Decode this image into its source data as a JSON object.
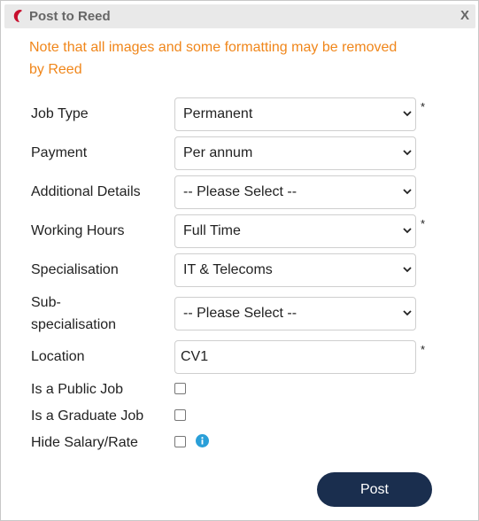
{
  "dialog": {
    "title": "Post to Reed",
    "close_label": "X",
    "note": "Note that all images and some formatting may be removed by Reed"
  },
  "form": {
    "job_type": {
      "label": "Job Type",
      "value": "Permanent",
      "required": "*"
    },
    "payment": {
      "label": "Payment",
      "value": "Per annum"
    },
    "additional_details": {
      "label": "Additional Details",
      "value": "-- Please Select --"
    },
    "working_hours": {
      "label": "Working Hours",
      "value": "Full Time",
      "required": "*"
    },
    "specialisation": {
      "label": "Specialisation",
      "value": "IT & Telecoms"
    },
    "sub_specialisation": {
      "label_line1": "Sub-",
      "label_line2": "specialisation",
      "value": "-- Please Select --"
    },
    "location": {
      "label": "Location",
      "value": "CV1",
      "required": "*"
    },
    "public_job": {
      "label": "Is a Public Job",
      "checked": false
    },
    "graduate_job": {
      "label": "Is a Graduate Job",
      "checked": false
    },
    "hide_salary": {
      "label": "Hide Salary/Rate",
      "checked": false
    }
  },
  "actions": {
    "post_label": "Post"
  },
  "colors": {
    "accent": "#f0861a",
    "button": "#1a2e4e",
    "info": "#2a9fd8",
    "brand": "#c8102e"
  },
  "icons": {
    "brand": "reed-logo-icon",
    "info": "info-icon",
    "dropdown": "chevron-down-icon"
  }
}
